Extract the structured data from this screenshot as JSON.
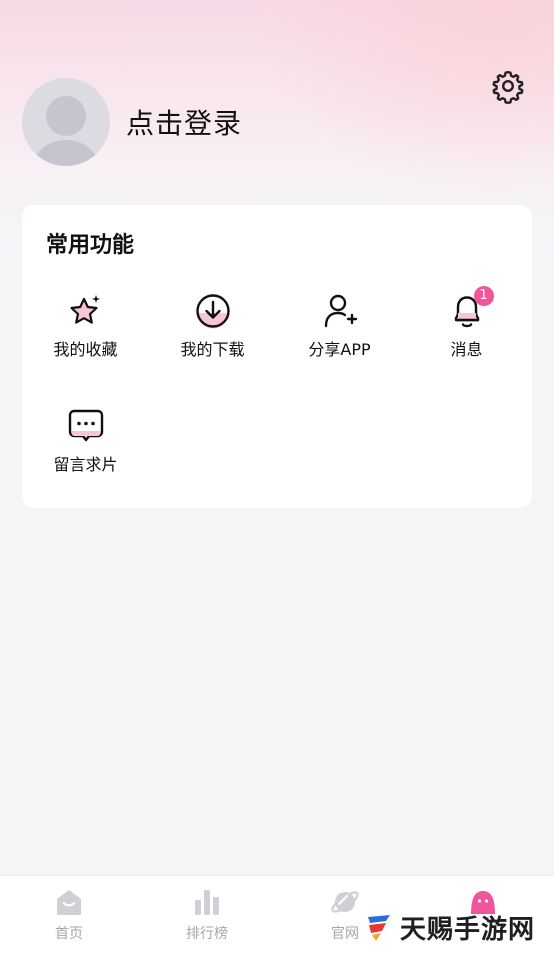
{
  "header": {
    "login_text": "点击登录",
    "settings_icon": "gear-icon",
    "avatar_icon": "default-avatar"
  },
  "functions": {
    "title": "常用功能",
    "items": [
      {
        "label": "我的收藏",
        "icon": "star-sparkle-icon"
      },
      {
        "label": "我的下载",
        "icon": "download-icon"
      },
      {
        "label": "分享APP",
        "icon": "add-user-icon"
      },
      {
        "label": "消息",
        "icon": "bell-icon",
        "badge": "1"
      },
      {
        "label": "留言求片",
        "icon": "chat-bubble-icon"
      }
    ]
  },
  "tabbar": {
    "items": [
      {
        "label": "首页",
        "icon": "home-icon"
      },
      {
        "label": "排行榜",
        "icon": "ranking-icon"
      },
      {
        "label": "官网",
        "icon": "planet-icon"
      },
      {
        "label": "",
        "icon": "profile-icon"
      }
    ]
  },
  "watermark": {
    "text": "天赐手游网"
  },
  "colors": {
    "accent": "#f0559a",
    "pink_fill": "#f7c6d6",
    "tab_inactive": "#a6a6ae"
  }
}
